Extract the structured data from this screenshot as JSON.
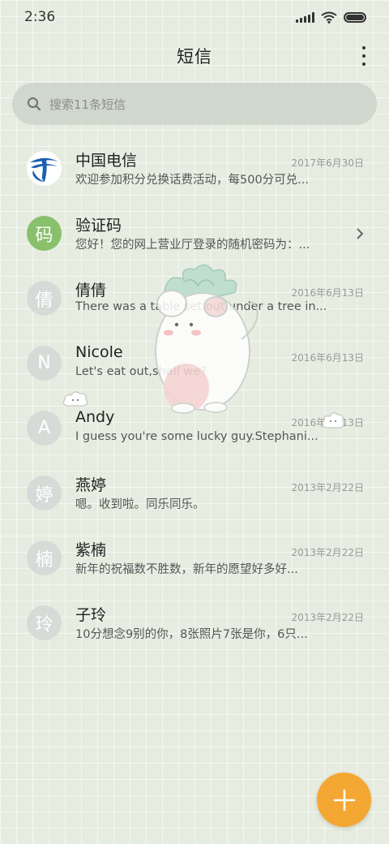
{
  "status_bar": {
    "time": "2:36",
    "icons": [
      "signal-icon",
      "wifi-icon",
      "battery-icon"
    ]
  },
  "app_bar": {
    "title": "短信",
    "menu_icon": "more-vertical-icon"
  },
  "search": {
    "placeholder": "搜索11条短信",
    "icon": "search-icon"
  },
  "conversations": [
    {
      "name": "中国电信",
      "preview": "欢迎参加积分兑换话费活动，每500分可兑...",
      "date": "2017年6月30日",
      "avatar": "china-telecom-logo"
    },
    {
      "name": "验证码",
      "preview": "您好！您的网上营业厅登录的随机密码为：...",
      "date": "",
      "avatar": "码",
      "chevron": true
    },
    {
      "name": "倩倩",
      "preview": "There was a table set out under a tree in...",
      "date": "2016年6月13日",
      "avatar": "倩"
    },
    {
      "name": "Nicole",
      "preview": "Let's eat out,shall we?",
      "date": "2016年6月13日",
      "avatar": "N"
    },
    {
      "name": "Andy",
      "preview": "I guess you're some lucky guy.Stephani...",
      "date": "2016年6月13日",
      "avatar": "A"
    },
    {
      "name": "燕婷",
      "preview": "嗯。收到啦。同乐同乐。",
      "date": "2013年2月22日",
      "avatar": "婷"
    },
    {
      "name": "紫楠",
      "preview": "新年的祝福数不胜数，新年的愿望好多好...",
      "date": "2013年2月22日",
      "avatar": "楠"
    },
    {
      "name": "子玲",
      "preview": "10分想念9别的你，8张照片7张是你，6只...",
      "date": "2013年2月22日",
      "avatar": "玲"
    }
  ],
  "fab": {
    "icon": "plus-icon"
  },
  "colors": {
    "accent": "#f5a733",
    "verification_avatar": "#88c06b",
    "background": "#e6ede0"
  }
}
